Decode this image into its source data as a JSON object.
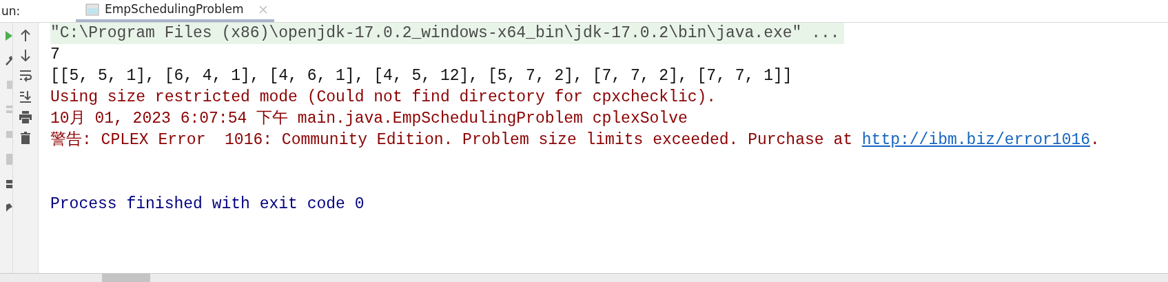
{
  "run_label": "un:",
  "tabs": [
    {
      "label": "EmpSchedulingProblem",
      "selected": true
    }
  ],
  "console": [
    {
      "kind": "command",
      "segments": [
        {
          "text": "\"C:\\Program Files (x86)\\openjdk-17.0.2_windows-x64_bin\\jdk-17.0.2\\bin\\java.exe\" ..."
        }
      ]
    },
    {
      "kind": "output",
      "segments": [
        {
          "text": "7"
        }
      ]
    },
    {
      "kind": "output",
      "segments": [
        {
          "text": "[[5, 5, 1], [6, 4, 1], [4, 6, 1], [4, 5, 12], [5, 7, 2], [7, 7, 2], [7, 7, 1]]"
        }
      ]
    },
    {
      "kind": "error",
      "segments": [
        {
          "text": "Using size restricted mode (Could not find directory for cpxchecklic)."
        }
      ]
    },
    {
      "kind": "error",
      "segments": [
        {
          "text": "10月 01, 2023 6:07:54 下午 main.java.EmpSchedulingProblem cplexSolve"
        }
      ]
    },
    {
      "kind": "error",
      "segments": [
        {
          "text": "警告: CPLEX Error  1016: Community Edition. Problem size limits exceeded. Purchase at "
        },
        {
          "text": "http://ibm.biz/error1016",
          "link": true
        },
        {
          "text": "."
        }
      ]
    },
    {
      "kind": "exit",
      "segments": [
        {
          "text": "Process finished with exit code 0"
        }
      ]
    }
  ]
}
